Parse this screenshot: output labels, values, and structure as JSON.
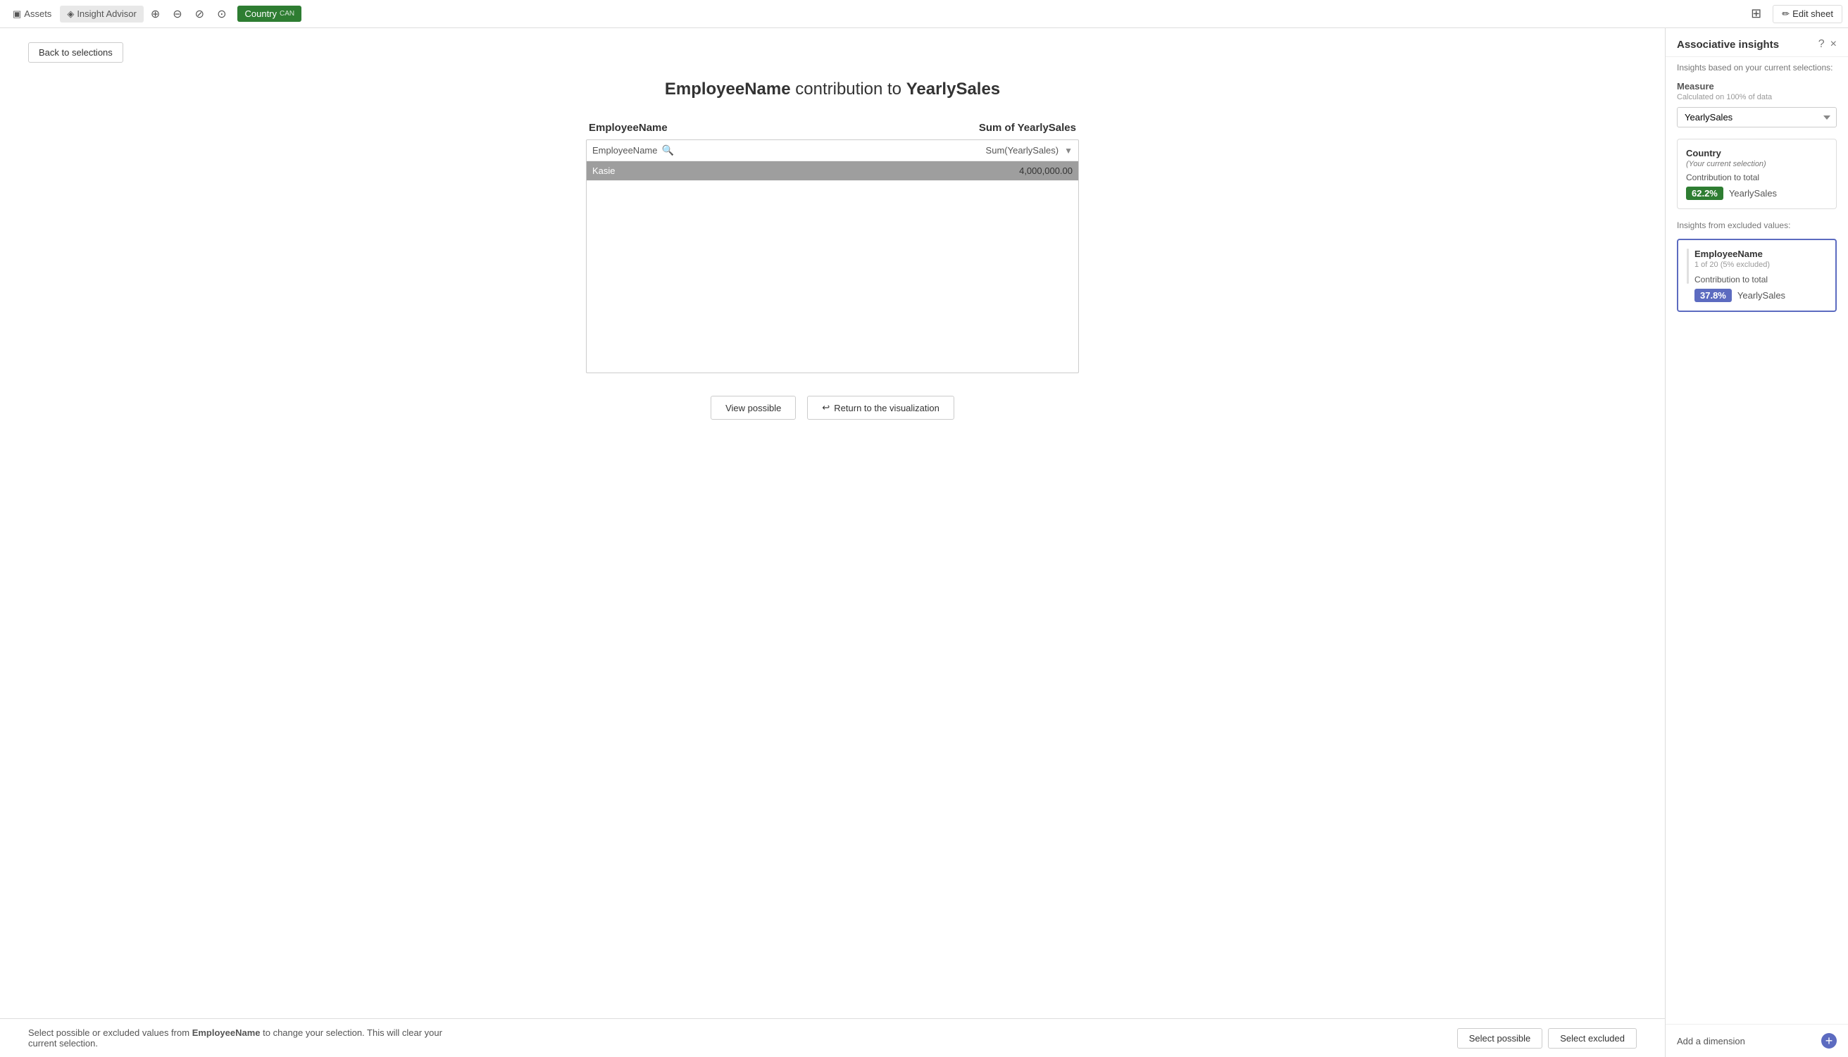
{
  "topbar": {
    "assets_label": "Assets",
    "insight_advisor_label": "Insight Advisor",
    "country_tab_label": "Country",
    "country_tab_sub": "CAN",
    "edit_sheet_label": "Edit sheet"
  },
  "main": {
    "back_button_label": "Back to selections",
    "page_title_part1": "EmployeeName",
    "page_title_middle": " contribution to ",
    "page_title_part2": "YearlySales",
    "col_dimension": "EmployeeName",
    "col_measure": "Sum of YearlySales",
    "table_dim_placeholder": "EmployeeName",
    "table_measure_header": "Sum(YearlySales)",
    "table_rows": [
      {
        "name": "Kasie",
        "value": "4,000,000.00",
        "selected": true
      }
    ],
    "view_possible_label": "View possible",
    "return_viz_label": "Return to the visualization"
  },
  "bottom_bar": {
    "text_prefix": "Select possible or excluded values from ",
    "field_name": "EmployeeName",
    "text_suffix": " to change your selection. This will clear your current selection.",
    "select_possible_label": "Select possible",
    "select_excluded_label": "Select excluded"
  },
  "right_panel": {
    "title": "Associative insights",
    "help_icon": "?",
    "close_icon": "×",
    "subtitle": "Insights based on your current selections:",
    "measure_section": {
      "title": "Measure",
      "sub": "Calculated on 100% of data",
      "selected_value": "YearlySales",
      "options": [
        "YearlySales"
      ]
    },
    "current_selection_card": {
      "title": "Country",
      "sub": "(Your current selection)",
      "contribution_label": "Contribution to total",
      "badge_value": "62.2%",
      "measure_label": "YearlySales"
    },
    "excluded_section_label": "Insights from excluded values:",
    "excluded_card": {
      "title": "EmployeeName",
      "sub": "1 of 20 (5% excluded)",
      "contribution_label": "Contribution to total",
      "badge_value": "37.8%",
      "measure_label": "YearlySales"
    },
    "add_dimension_label": "Add a dimension",
    "add_dimension_btn": "+"
  },
  "icons": {
    "back_arrow": "←",
    "search": "🔍",
    "sort": "▼",
    "grid": "⊞",
    "pencil": "✏",
    "return_arrow": "↩"
  }
}
